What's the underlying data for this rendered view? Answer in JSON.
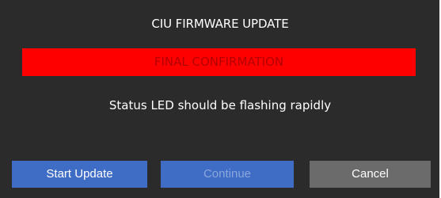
{
  "dialog": {
    "title": "CIU FIRMWARE UPDATE",
    "banner": {
      "text": "FINAL CONFIRMATION",
      "background_color": "#ff0000",
      "text_color": "#b40000"
    },
    "status_message": "Status LED should be flashing rapidly",
    "buttons": {
      "start_update": {
        "label": "Start Update",
        "state": "enabled"
      },
      "continue": {
        "label": "Continue",
        "state": "disabled"
      },
      "cancel": {
        "label": "Cancel",
        "state": "enabled"
      }
    },
    "colors": {
      "background": "#2b2b2b",
      "primary_button": "#3f6cc4",
      "cancel_button": "#6b6b6b"
    }
  }
}
